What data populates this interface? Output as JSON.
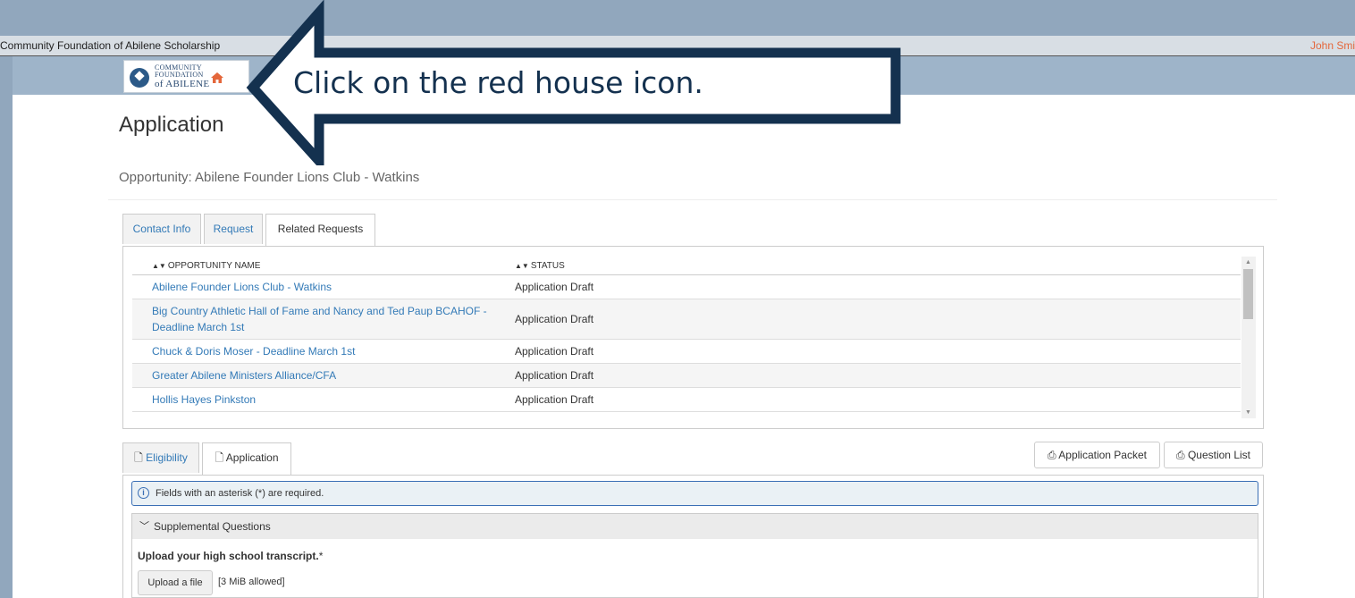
{
  "topbar": {
    "title": "Community Foundation of Abilene Scholarship",
    "user": "John Smi"
  },
  "logo": {
    "line1": "COMMUNITY",
    "line2": "FOUNDATION",
    "line3": "of ABILENE"
  },
  "page": {
    "title": "Application",
    "opportunity": "Opportunity: Abilene Founder Lions Club - Watkins"
  },
  "tabs_top": [
    "Contact Info",
    "Request",
    "Related Requests"
  ],
  "related": {
    "columns": [
      "OPPORTUNITY NAME",
      "STATUS"
    ],
    "rows": [
      {
        "name": "Abilene Founder Lions Club - Watkins",
        "status": "Application Draft"
      },
      {
        "name": "Big Country Athletic Hall of Fame and Nancy and Ted Paup BCAHOF - Deadline March 1st",
        "status": "Application Draft"
      },
      {
        "name": "Chuck & Doris Moser - Deadline March 1st",
        "status": "Application Draft"
      },
      {
        "name": "Greater Abilene Ministers Alliance/CFA",
        "status": "Application Draft"
      },
      {
        "name": "Hollis Hayes Pinkston",
        "status": "Application Draft"
      }
    ]
  },
  "tabs_bottom": [
    "Eligibility",
    "Application"
  ],
  "buttons": {
    "application_packet": "Application Packet",
    "question_list": "Question List"
  },
  "info": "Fields with an asterisk (*) are required.",
  "section": "Supplemental Questions",
  "question": {
    "label": "Upload your high school transcript.",
    "asterisk": "*",
    "upload": "Upload a file",
    "limit": "[3 MiB allowed]"
  },
  "callout": "Click on the red house icon.",
  "colors": {
    "callout_border": "#14314f",
    "home_icon": "#e4673b",
    "link": "#337ab7"
  }
}
